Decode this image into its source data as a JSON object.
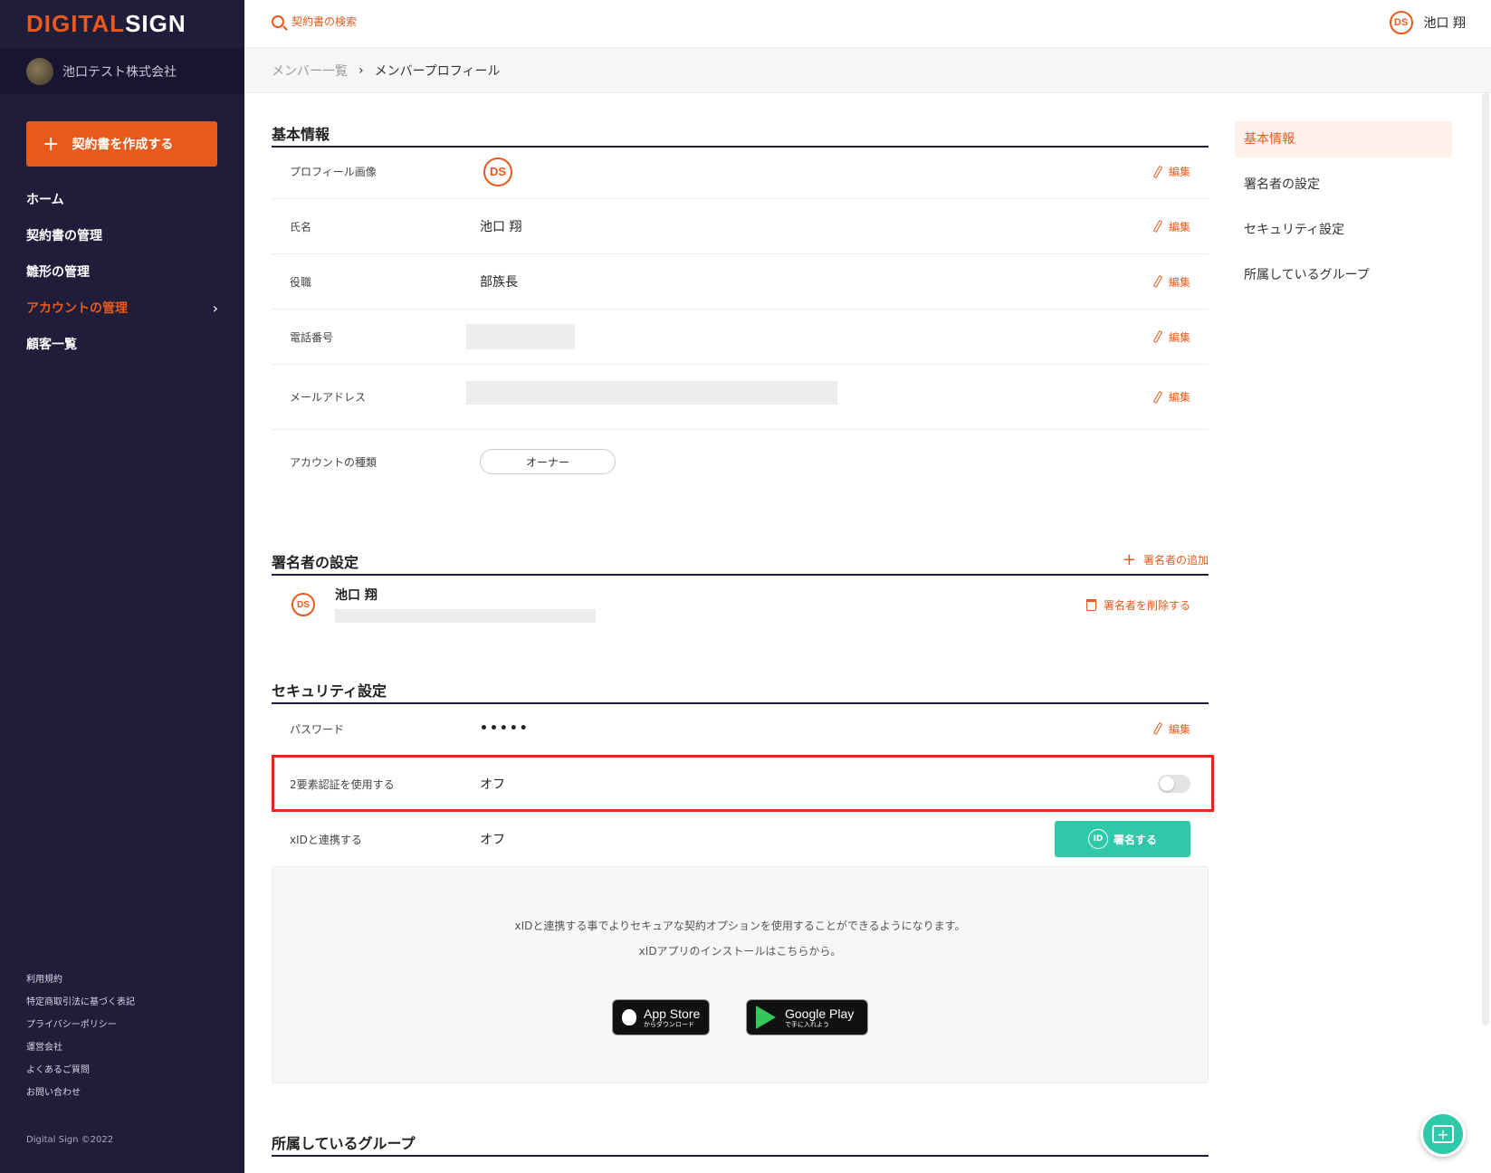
{
  "app": {
    "logo_part1": "DIGITAL",
    "logo_part2": "SIGN"
  },
  "sidebar": {
    "company": "池口テスト株式会社",
    "create_button": "契約書を作成する",
    "items": [
      {
        "label": "ホーム"
      },
      {
        "label": "契約書の管理"
      },
      {
        "label": "雛形の管理"
      },
      {
        "label": "アカウントの管理",
        "active": true
      },
      {
        "label": "顧客一覧"
      }
    ],
    "footer_links": [
      "利用規約",
      "特定商取引法に基づく表記",
      "プライバシーポリシー",
      "運営会社",
      "よくあるご質問",
      "お問い合わせ"
    ],
    "copyright": "Digital Sign ©2022"
  },
  "header": {
    "search_label": "契約書の検索",
    "user_name": "池口 翔",
    "avatar_text": "DS"
  },
  "breadcrumb": {
    "parent": "メンバー一覧",
    "separator": "›",
    "current": "メンバープロフィール"
  },
  "basic_info": {
    "title": "基本情報",
    "edit_label": "編集",
    "rows": {
      "profile_image": {
        "label": "プロフィール画像"
      },
      "name": {
        "label": "氏名",
        "value": "池口 翔"
      },
      "position": {
        "label": "役職",
        "value": "部族長"
      },
      "phone": {
        "label": "電話番号"
      },
      "email": {
        "label": "メールアドレス"
      },
      "account_type": {
        "label": "アカウントの種類",
        "value": "オーナー"
      }
    }
  },
  "signer": {
    "title": "署名者の設定",
    "add_label": "署名者の追加",
    "name": "池口 翔",
    "delete_label": "署名者を削除する"
  },
  "security": {
    "title": "セキュリティ設定",
    "password": {
      "label": "パスワード",
      "value": "•••••"
    },
    "two_factor": {
      "label": "2要素認証を使用する",
      "value": "オフ",
      "enabled": false
    },
    "xid": {
      "label": "xIDと連携する",
      "value": "オフ",
      "button": "署名する",
      "button_icon": "ID"
    },
    "info_line1": "xIDと連携する事でよりセキュアな契約オプションを使用することができるようになります。",
    "info_line2": "xIDアプリのインストールはこちらから。",
    "app_store": {
      "big": "App Store",
      "small": "からダウンロード"
    },
    "google_play": {
      "big": "Google Play",
      "small": "で手に入れよう"
    }
  },
  "groups": {
    "title": "所属しているグループ"
  },
  "right_nav": {
    "items": [
      {
        "label": "基本情報",
        "active": true
      },
      {
        "label": "署名者の設定"
      },
      {
        "label": "セキュリティ設定"
      },
      {
        "label": "所属しているグループ"
      }
    ]
  },
  "colors": {
    "accent": "#e85a1c",
    "sidebar": "#1f1d3a",
    "xid": "#2fc8a8",
    "highlight": "#e02a1a"
  }
}
